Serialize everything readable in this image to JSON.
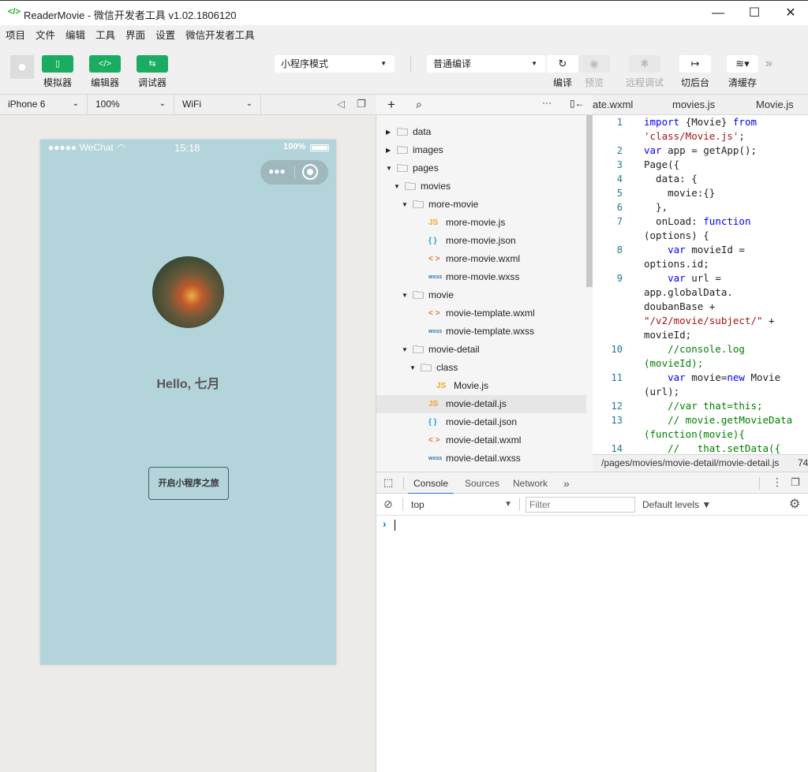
{
  "window": {
    "title": "ReaderMovie - 微信开发者工具 v1.02.1806120",
    "logo": "</>",
    "minimize": "—",
    "maximize": "☐",
    "close": "✕"
  },
  "menu": [
    "项目",
    "文件",
    "编辑",
    "工具",
    "界面",
    "设置",
    "微信开发者工具"
  ],
  "toolbar": {
    "simulator": "模拟器",
    "editor": "编辑器",
    "debugger": "调试器",
    "mode": "小程序模式",
    "compile_mode": "普通编译",
    "compile": "编译",
    "preview": "预览",
    "remote_debug": "远程调试",
    "background": "切后台",
    "clear_cache": "清缓存"
  },
  "device": {
    "model": "iPhone 6",
    "zoom": "100%",
    "network": "WiFi"
  },
  "phone": {
    "carrier": "●●●●● WeChat",
    "time": "15:18",
    "battery": "100%",
    "greeting": "Hello, 七月",
    "button": "开启小程序之旅",
    "background": "#b3d4da"
  },
  "tree": [
    {
      "name": "data",
      "type": "folder",
      "depth": 0,
      "open": false
    },
    {
      "name": "images",
      "type": "folder",
      "depth": 0,
      "open": false
    },
    {
      "name": "pages",
      "type": "folder",
      "depth": 0,
      "open": true
    },
    {
      "name": "movies",
      "type": "folder",
      "depth": 1,
      "open": true
    },
    {
      "name": "more-movie",
      "type": "folder",
      "depth": 2,
      "open": true
    },
    {
      "name": "more-movie.js",
      "type": "js",
      "depth": 3
    },
    {
      "name": "more-movie.json",
      "type": "json",
      "depth": 3
    },
    {
      "name": "more-movie.wxml",
      "type": "wxml",
      "depth": 3
    },
    {
      "name": "more-movie.wxss",
      "type": "wxss",
      "depth": 3
    },
    {
      "name": "movie",
      "type": "folder",
      "depth": 2,
      "open": true
    },
    {
      "name": "movie-template.wxml",
      "type": "wxml",
      "depth": 3
    },
    {
      "name": "movie-template.wxss",
      "type": "wxss",
      "depth": 3
    },
    {
      "name": "movie-detail",
      "type": "folder",
      "depth": 2,
      "open": true
    },
    {
      "name": "class",
      "type": "folder",
      "depth": 3,
      "open": true
    },
    {
      "name": "Movie.js",
      "type": "js",
      "depth": 4
    },
    {
      "name": "movie-detail.js",
      "type": "js",
      "depth": 3,
      "active": true
    },
    {
      "name": "movie-detail.json",
      "type": "json",
      "depth": 3
    },
    {
      "name": "movie-detail.wxml",
      "type": "wxml",
      "depth": 3
    },
    {
      "name": "movie-detail.wxss",
      "type": "wxss",
      "depth": 3
    }
  ],
  "file_icons": {
    "js": "JS",
    "json": "{ }",
    "wxml": "< >",
    "wxss": "wxss"
  },
  "editor": {
    "tabs": [
      "ate.wxml",
      "movies.js",
      "Movie.js"
    ],
    "path": "/pages/movies/movie-detail/movie-detail.js",
    "position": "74",
    "lines": [
      {
        "n": "1",
        "s": [
          [
            "kw",
            "import "
          ],
          [
            "",
            "{Movie} "
          ],
          [
            "kw",
            "from"
          ]
        ]
      },
      {
        "n": "",
        "s": [
          [
            "str",
            "'class/Movie.js'"
          ],
          [
            "",
            ";"
          ]
        ]
      },
      {
        "n": "2",
        "s": [
          [
            "kw",
            "var "
          ],
          [
            "",
            "app = getApp();"
          ]
        ]
      },
      {
        "n": "3",
        "s": [
          [
            "",
            "Page({"
          ]
        ]
      },
      {
        "n": "4",
        "s": [
          [
            "",
            "  data: {"
          ]
        ]
      },
      {
        "n": "5",
        "s": [
          [
            "",
            "    movie:{}"
          ]
        ]
      },
      {
        "n": "6",
        "s": [
          [
            "",
            "  },"
          ]
        ]
      },
      {
        "n": "7",
        "s": [
          [
            "",
            "  onLoad: "
          ],
          [
            "kw",
            "function"
          ]
        ]
      },
      {
        "n": "",
        "s": [
          [
            "",
            "(options) {"
          ]
        ]
      },
      {
        "n": "8",
        "s": [
          [
            "kw",
            "    var "
          ],
          [
            "",
            "movieId ="
          ]
        ]
      },
      {
        "n": "",
        "s": [
          [
            "",
            "options.id;"
          ]
        ]
      },
      {
        "n": "9",
        "s": [
          [
            "kw",
            "    var "
          ],
          [
            "",
            "url ="
          ]
        ]
      },
      {
        "n": "",
        "s": [
          [
            "",
            "app.globalData."
          ]
        ]
      },
      {
        "n": "",
        "s": [
          [
            "",
            "doubanBase +"
          ]
        ]
      },
      {
        "n": "",
        "s": [
          [
            "str",
            "\"/v2/movie/subject/\""
          ],
          [
            "",
            " +"
          ]
        ]
      },
      {
        "n": "",
        "s": [
          [
            "",
            "movieId;"
          ]
        ]
      },
      {
        "n": "10",
        "s": [
          [
            "cm",
            "    //console.log"
          ]
        ]
      },
      {
        "n": "",
        "s": [
          [
            "cm",
            "(movieId);"
          ]
        ]
      },
      {
        "n": "11",
        "s": [
          [
            "kw",
            "    var "
          ],
          [
            "",
            "movie="
          ],
          [
            "kw",
            "new "
          ],
          [
            "",
            "Movie"
          ]
        ]
      },
      {
        "n": "",
        "s": [
          [
            "",
            "(url);"
          ]
        ]
      },
      {
        "n": "12",
        "s": [
          [
            "cm",
            "    //var that=this;"
          ]
        ]
      },
      {
        "n": "13",
        "s": [
          [
            "cm",
            "    // movie.getMovieData"
          ]
        ]
      },
      {
        "n": "",
        "s": [
          [
            "cm",
            "(function(movie){"
          ]
        ]
      },
      {
        "n": "14",
        "s": [
          [
            "cm",
            "    //   that.setData({"
          ]
        ]
      }
    ]
  },
  "devtools": {
    "tabs": [
      "Console",
      "Sources",
      "Network"
    ],
    "more": "»",
    "context": "top",
    "filter_placeholder": "Filter",
    "levels": "Default levels ▼",
    "prompt": "›"
  },
  "colors": {
    "accent": "#1aad62",
    "tab_active": "#1a73e8"
  }
}
